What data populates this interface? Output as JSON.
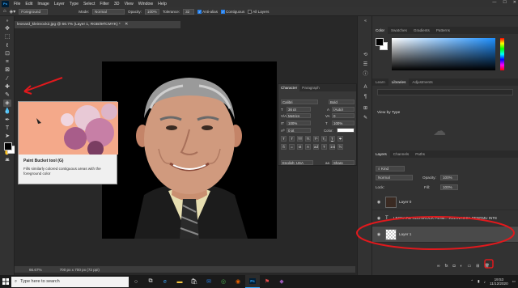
{
  "menubar": {
    "logo": "Ps",
    "items": [
      "File",
      "Edit",
      "Image",
      "Layer",
      "Type",
      "Select",
      "Filter",
      "3D",
      "View",
      "Window",
      "Help"
    ]
  },
  "options": {
    "fill_source": "Foreground",
    "mode_label": "Mode:",
    "mode_value": "Normal",
    "opacity_label": "Opacity:",
    "opacity_value": "100%",
    "tolerance_label": "Tolerance:",
    "tolerance_value": "32",
    "anti_alias": "Anti-alias",
    "contiguous": "Contiguous",
    "all_layers": "All Layers"
  },
  "document": {
    "tab_title": "leonard_kleinrock2.jpg @ 66.7% (Layer 1, RGB/8#/CMYK) *",
    "zoom": "66.67%",
    "size": "700 px x 700 px (72 ppi)"
  },
  "tooltip": {
    "title": "Paint Bucket tool (G)",
    "description": "Fills similarly colored contiguous areas with the foreground color"
  },
  "character_panel": {
    "tabs": [
      "Character",
      "Paragraph"
    ],
    "font_family": "Calibri",
    "font_style": "Bold",
    "font_size": "36 pt",
    "leading": "(Auto)",
    "kerning": "Metrics",
    "tracking": "0",
    "vertical_scale": "100%",
    "horizontal_scale": "100%",
    "baseline": "0 pt",
    "color_label": "Color:",
    "language": "English: USA",
    "anti_alias": "Sharp",
    "style_buttons": [
      "T",
      "T",
      "TT",
      "Tt",
      "T¹",
      "T₁",
      "T",
      "T"
    ],
    "opentype_buttons": [
      "fi",
      "ℴ",
      "st",
      "A",
      "ad",
      "T",
      "1st",
      "½"
    ]
  },
  "right_panels": {
    "color_tabs": [
      "Color",
      "Swatches",
      "Gradients",
      "Patterns"
    ],
    "lib_tabs": [
      "Learn",
      "Libraries",
      "Adjustments"
    ],
    "view_by": "View by Type",
    "layers_tabs": [
      "Layers",
      "Channels",
      "Paths"
    ],
    "kind_filter": "Kind",
    "blend_mode": "Normal",
    "opacity_label": "Opacity:",
    "opacity_value": "100%",
    "lock_label": "Lock:",
    "fill_label": "Fill:",
    "fill_value": "100%",
    "layers": [
      {
        "name": "Layer 0",
        "selected": false
      },
      {
        "name": "LEONARD KLEINROCK PENE....KLEINROCK PENEMU INTE",
        "selected": false
      },
      {
        "name": "Layer 1",
        "selected": true
      }
    ]
  },
  "taskbar": {
    "search_placeholder": "Type here to search",
    "time": "19:53",
    "date": "11/12/2020"
  },
  "colors": {
    "annotation": "#e0191d",
    "accent": "#2680eb"
  }
}
